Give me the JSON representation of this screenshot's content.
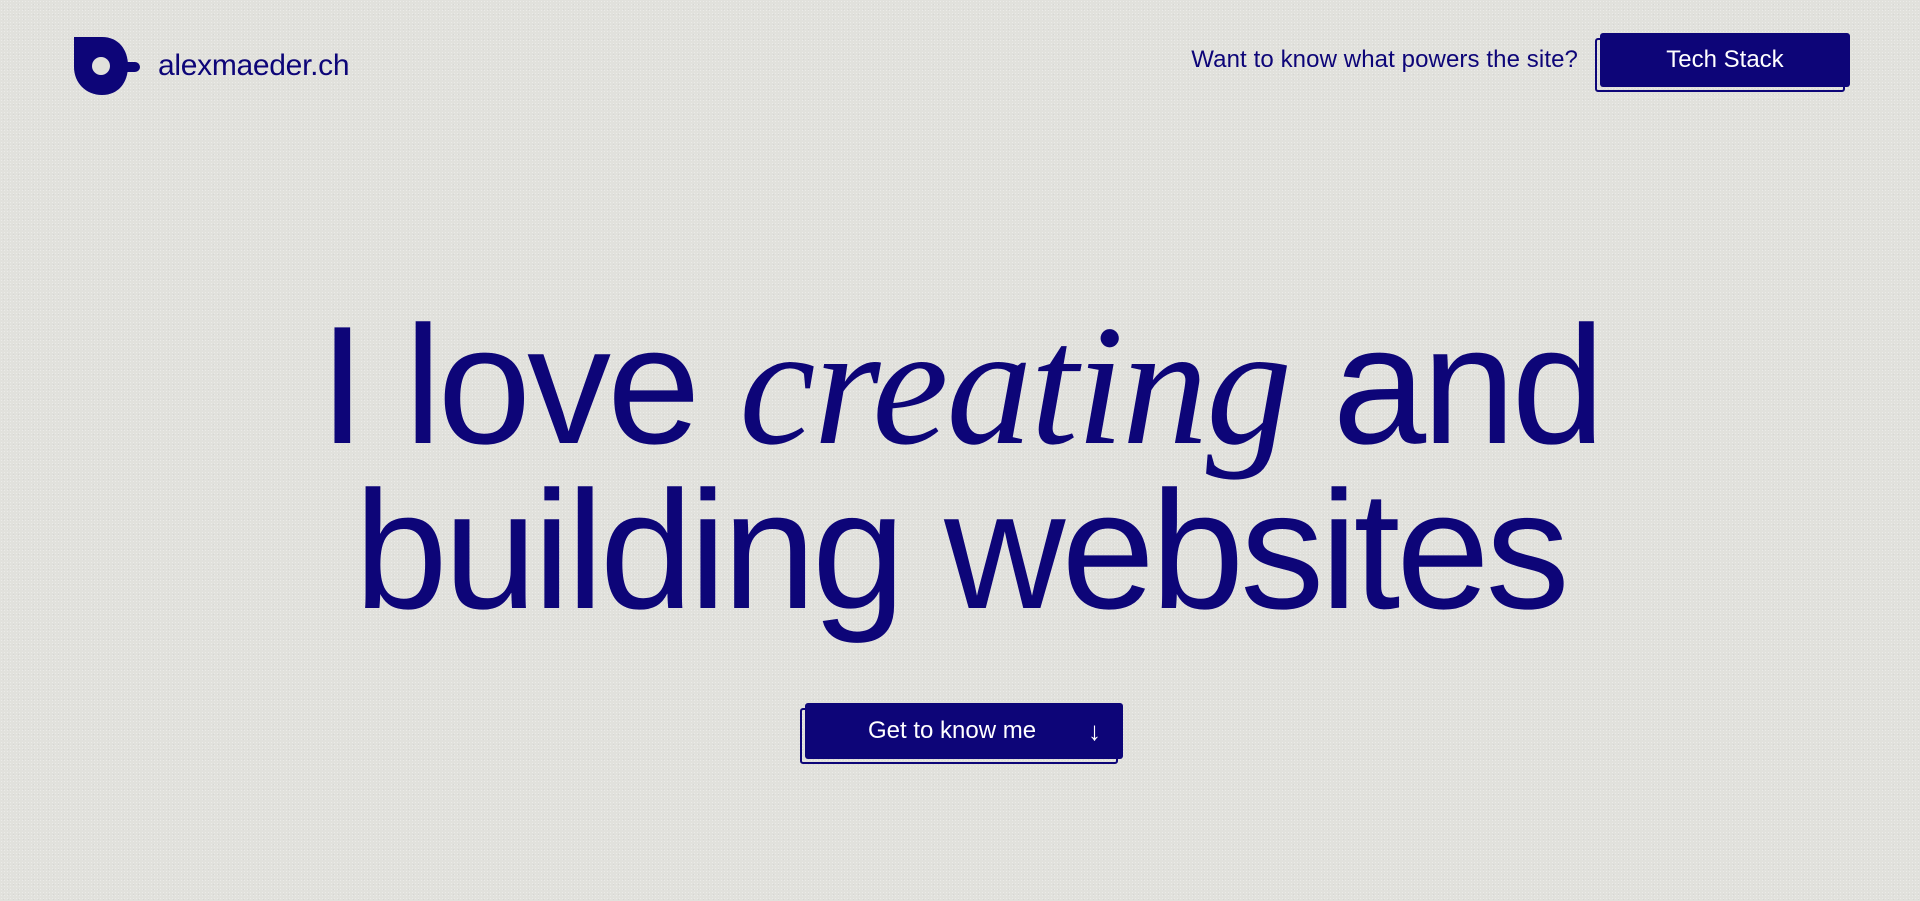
{
  "header": {
    "brand_name": "alexmaeder.ch",
    "question": "Want to know what powers the site?",
    "tech_button_label": "Tech Stack"
  },
  "hero": {
    "line1_before": "I love",
    "line1_italic": "creating",
    "line1_after": "and",
    "line2": "building websites"
  },
  "cta": {
    "label": "Get to know me",
    "arrow": "↓"
  },
  "colors": {
    "background": "#e1e1dc",
    "accent": "#0d0578",
    "button_text": "#ffffff"
  },
  "icons": {
    "logo": "brand-logo-icon",
    "cta_arrow": "arrow-down-icon"
  }
}
